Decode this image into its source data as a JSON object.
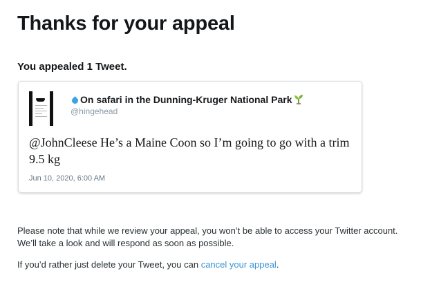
{
  "page": {
    "title": "Thanks for your appeal",
    "summary": "You appealed 1 Tweet."
  },
  "tweet": {
    "display_name": "On safari in the Dunning-Kruger National Park",
    "handle": "@hingehead",
    "text": "@JohnCleese He’s a Maine Coon so I’m going to go with a trim 9.5 kg",
    "date": "Jun 10, 2020, 6:00 AM",
    "name_prefix_icon": "water-drop-icon",
    "name_suffix_icon": "seedling-icon",
    "avatar_icon": "avatar-sunglasses"
  },
  "notice": {
    "review_note": "Please note that while we review your appeal, you won’t be able to access your Twitter account. We’ll take a look and will respond as soon as possible.",
    "delete_prefix": "If you’d rather just delete your Tweet, you can ",
    "cancel_link": "cancel your appeal",
    "delete_suffix": "."
  },
  "colors": {
    "link": "#3b94d9",
    "muted_text": "#657786",
    "handle_text": "#8899a6"
  }
}
